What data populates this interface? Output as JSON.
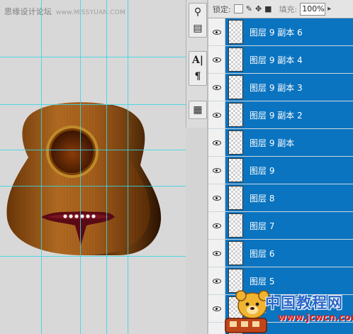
{
  "canvas": {
    "watermark_text": "思缘设计论坛",
    "watermark_url": "www.MISSYUAN.COM"
  },
  "tools": [
    {
      "name": "clone-source-icon",
      "glyph": "⚲"
    },
    {
      "name": "tool-presets-icon",
      "glyph": "▤"
    },
    {
      "name": "character-icon",
      "glyph": "A|"
    },
    {
      "name": "paragraph-icon",
      "glyph": "¶"
    },
    {
      "name": "layer-comps-icon",
      "glyph": "▦"
    }
  ],
  "layers_panel": {
    "lock_label": "锁定:",
    "fill_label": "填充:",
    "fill_value": "100%",
    "layers": [
      {
        "name": "图层 9 副本 6"
      },
      {
        "name": "图层 9 副本 4"
      },
      {
        "name": "图层 9 副本 3"
      },
      {
        "name": "图层 9 副本 2"
      },
      {
        "name": "图层 9 副本"
      },
      {
        "name": "图层 9"
      },
      {
        "name": "图层 8"
      },
      {
        "name": "图层 7"
      },
      {
        "name": "图层 6"
      },
      {
        "name": "图层 5"
      },
      {
        "name": "图层"
      },
      {
        "name": ""
      }
    ]
  },
  "logo": {
    "text": "中国教程网",
    "url": "www.jcwcn.com"
  },
  "colors": {
    "selection": "#0a74c0",
    "guide": "#37d7e6",
    "guitar_body": "#9a5a1a"
  }
}
